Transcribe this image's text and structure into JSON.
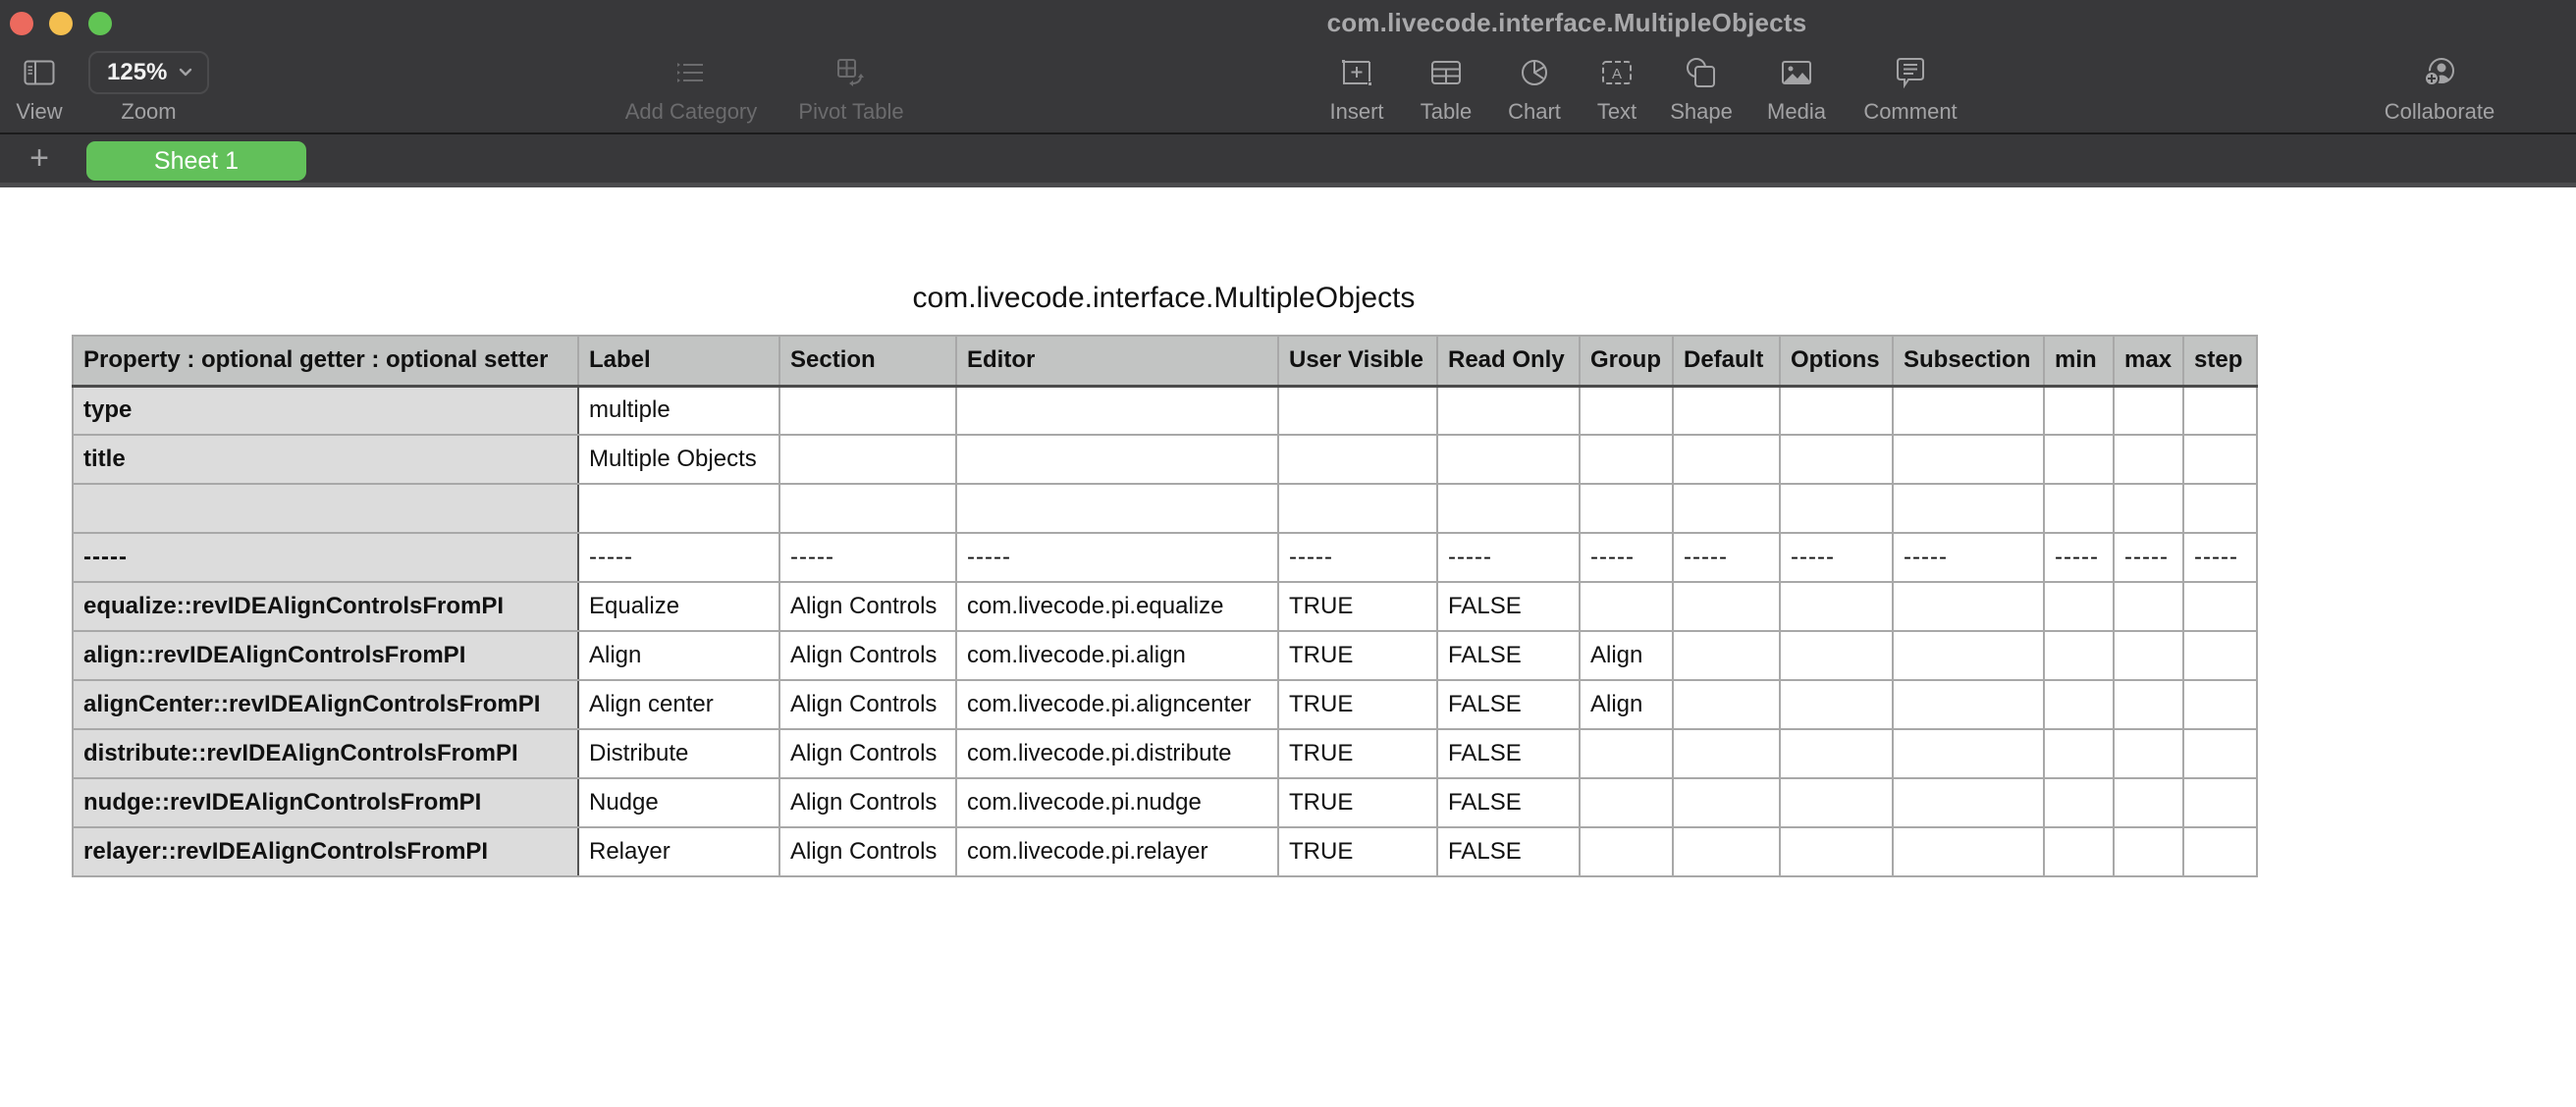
{
  "window": {
    "title": "com.livecode.interface.MultipleObjects",
    "traffic_lights": {
      "close_color": "#ec6a5e",
      "minimize_color": "#f4bf4f",
      "maximize_color": "#61c554"
    }
  },
  "toolbar": {
    "view": {
      "label": "View",
      "icon": "sidebar-icon"
    },
    "zoom": {
      "label": "Zoom",
      "value": "125%",
      "icon": "chevron-down-icon"
    },
    "add_category": {
      "label": "Add Category",
      "icon": "list-icon",
      "enabled": false
    },
    "pivot_table": {
      "label": "Pivot Table",
      "icon": "pivot-table-icon",
      "enabled": false
    },
    "insert": {
      "label": "Insert",
      "icon": "insert-icon"
    },
    "table": {
      "label": "Table",
      "icon": "table-icon"
    },
    "chart": {
      "label": "Chart",
      "icon": "chart-icon"
    },
    "text": {
      "label": "Text",
      "icon": "text-box-icon"
    },
    "shape": {
      "label": "Shape",
      "icon": "shape-icon"
    },
    "media": {
      "label": "Media",
      "icon": "image-icon"
    },
    "comment": {
      "label": "Comment",
      "icon": "comment-icon"
    },
    "collaborate": {
      "label": "Collaborate",
      "icon": "collaborate-icon"
    }
  },
  "sheets": {
    "add_label": "+",
    "tabs": [
      {
        "label": "Sheet 1",
        "active": true,
        "color": "#62c05a"
      }
    ]
  },
  "table": {
    "title": "com.livecode.interface.MultipleObjects",
    "columns": [
      "Property : optional getter : optional setter",
      "Label",
      "Section",
      "Editor",
      "User Visible",
      "Read Only",
      "Group",
      "Default",
      "Options",
      "Subsection",
      "min",
      "max",
      "step"
    ],
    "rows": [
      [
        "type",
        "multiple",
        "",
        "",
        "",
        "",
        "",
        "",
        "",
        "",
        "",
        "",
        ""
      ],
      [
        "title",
        "Multiple Objects",
        "",
        "",
        "",
        "",
        "",
        "",
        "",
        "",
        "",
        "",
        ""
      ],
      [
        "",
        "",
        "",
        "",
        "",
        "",
        "",
        "",
        "",
        "",
        "",
        "",
        ""
      ],
      [
        "-----",
        "-----",
        "-----",
        "-----",
        "-----",
        "-----",
        "-----",
        "-----",
        "-----",
        "-----",
        "-----",
        "-----",
        "-----"
      ],
      [
        "equalize::revIDEAlignControlsFromPI",
        "Equalize",
        "Align Controls",
        "com.livecode.pi.equalize",
        "TRUE",
        "FALSE",
        "",
        "",
        "",
        "",
        "",
        "",
        ""
      ],
      [
        "align::revIDEAlignControlsFromPI",
        "Align",
        "Align Controls",
        "com.livecode.pi.align",
        "TRUE",
        "FALSE",
        "Align",
        "",
        "",
        "",
        "",
        "",
        ""
      ],
      [
        "alignCenter::revIDEAlignControlsFromPI",
        "Align center",
        "Align Controls",
        "com.livecode.pi.aligncenter",
        "TRUE",
        "FALSE",
        "Align",
        "",
        "",
        "",
        "",
        "",
        ""
      ],
      [
        "distribute::revIDEAlignControlsFromPI",
        "Distribute",
        "Align Controls",
        "com.livecode.pi.distribute",
        "TRUE",
        "FALSE",
        "",
        "",
        "",
        "",
        "",
        "",
        ""
      ],
      [
        "nudge::revIDEAlignControlsFromPI",
        "Nudge",
        "Align Controls",
        "com.livecode.pi.nudge",
        "TRUE",
        "FALSE",
        "",
        "",
        "",
        "",
        "",
        "",
        ""
      ],
      [
        "relayer::revIDEAlignControlsFromPI",
        "Relayer",
        "Align Controls",
        "com.livecode.pi.relayer",
        "TRUE",
        "FALSE",
        "",
        "",
        "",
        "",
        "",
        "",
        ""
      ]
    ]
  }
}
